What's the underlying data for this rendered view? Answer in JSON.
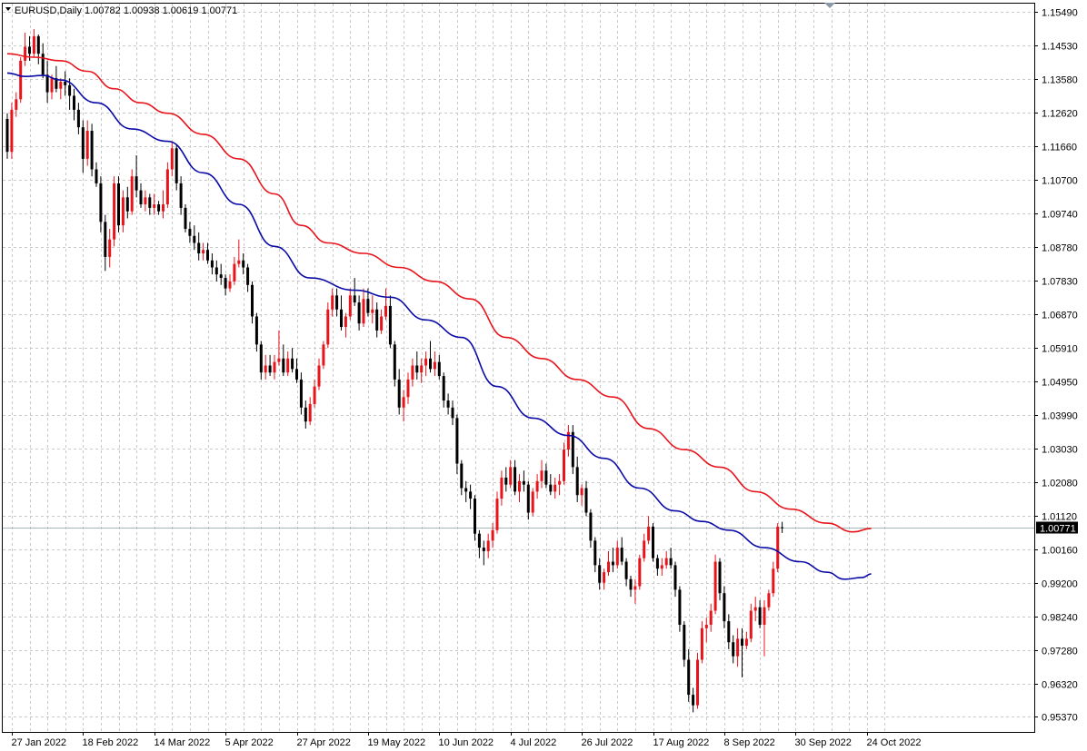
{
  "header": {
    "symbol_label": "EURUSD,Daily",
    "ohlc_label": "1.00782 1.00938 1.00619 1.00771"
  },
  "colors": {
    "bull_candle": "#e8141c",
    "bear_candle": "#000000",
    "ma_fast": "#0a0aa8",
    "ma_slow": "#e8141c",
    "grid": "#c8c8c8",
    "current_price_line": "#a8b4bc",
    "price_box": "#000000"
  },
  "icons": {
    "indicator_marker": "triangle-down-icon"
  },
  "chart_data": {
    "type": "candlestick",
    "symbol": "EURUSD",
    "timeframe": "Daily",
    "ohlc": {
      "open": 1.00782,
      "high": 1.00938,
      "low": 1.00619,
      "close": 1.00771
    },
    "current_price": 1.00771,
    "current_price_label": "1.00771",
    "ylim": [
      0.9494,
      1.1573
    ],
    "y_ticks": [
      "1.15490",
      "1.14530",
      "1.13580",
      "1.12620",
      "1.11660",
      "1.10700",
      "1.09740",
      "1.08780",
      "1.07830",
      "1.06870",
      "1.05910",
      "1.04950",
      "1.03990",
      "1.03030",
      "1.02080",
      "1.01120",
      "1.00160",
      "0.99200",
      "0.98240",
      "0.97280",
      "0.96320",
      "0.95370"
    ],
    "x_ticks": [
      {
        "label": "27 Jan 2022",
        "index": 1
      },
      {
        "label": "18 Feb 2022",
        "index": 17
      },
      {
        "label": "14 Mar 2022",
        "index": 33
      },
      {
        "label": "5 Apr 2022",
        "index": 49
      },
      {
        "label": "27 Apr 2022",
        "index": 65
      },
      {
        "label": "19 May 2022",
        "index": 81
      },
      {
        "label": "10 Jun 2022",
        "index": 97
      },
      {
        "label": "4 Jul 2022",
        "index": 113
      },
      {
        "label": "26 Jul 2022",
        "index": 129
      },
      {
        "label": "17 Aug 2022",
        "index": 145
      },
      {
        "label": "8 Sep 2022",
        "index": 161
      },
      {
        "label": "30 Sep 2022",
        "index": 177
      },
      {
        "label": "24 Oct 2022",
        "index": 193
      }
    ],
    "grid": true,
    "candles": [
      [
        1.1244,
        1.126,
        1.113,
        1.115
      ],
      [
        1.115,
        1.129,
        1.113,
        1.127
      ],
      [
        1.127,
        1.132,
        1.125,
        1.13
      ],
      [
        1.13,
        1.142,
        1.129,
        1.141
      ],
      [
        1.141,
        1.149,
        1.1395,
        1.145
      ],
      [
        1.145,
        1.148,
        1.141,
        1.143
      ],
      [
        1.143,
        1.15,
        1.142,
        1.148
      ],
      [
        1.148,
        1.1485,
        1.14,
        1.143
      ],
      [
        1.143,
        1.146,
        1.136,
        1.137
      ],
      [
        1.137,
        1.141,
        1.129,
        1.132
      ],
      [
        1.132,
        1.137,
        1.13,
        1.136
      ],
      [
        1.136,
        1.1395,
        1.132,
        1.133
      ],
      [
        1.133,
        1.136,
        1.13,
        1.135
      ],
      [
        1.135,
        1.138,
        1.131,
        1.134
      ],
      [
        1.134,
        1.136,
        1.127,
        1.131
      ],
      [
        1.131,
        1.133,
        1.124,
        1.127
      ],
      [
        1.127,
        1.129,
        1.12,
        1.122
      ],
      [
        1.122,
        1.124,
        1.109,
        1.113
      ],
      [
        1.113,
        1.124,
        1.111,
        1.121
      ],
      [
        1.121,
        1.123,
        1.108,
        1.11
      ],
      [
        1.11,
        1.112,
        1.105,
        1.106
      ],
      [
        1.106,
        1.108,
        1.092,
        1.095
      ],
      [
        1.095,
        1.097,
        1.081,
        1.085
      ],
      [
        1.085,
        1.093,
        1.082,
        1.09
      ],
      [
        1.09,
        1.108,
        1.088,
        1.106
      ],
      [
        1.106,
        1.108,
        1.092,
        1.094
      ],
      [
        1.094,
        1.104,
        1.092,
        1.102
      ],
      [
        1.102,
        1.105,
        1.096,
        1.098
      ],
      [
        1.098,
        1.11,
        1.097,
        1.108
      ],
      [
        1.108,
        1.114,
        1.102,
        1.104
      ],
      [
        1.104,
        1.106,
        1.099,
        1.1
      ],
      [
        1.1,
        1.104,
        1.098,
        1.102
      ],
      [
        1.102,
        1.103,
        1.097,
        1.099
      ],
      [
        1.099,
        1.103,
        1.097,
        1.1
      ],
      [
        1.1,
        1.101,
        1.097,
        1.098
      ],
      [
        1.098,
        1.104,
        1.096,
        1.1
      ],
      [
        1.1,
        1.112,
        1.099,
        1.11
      ],
      [
        1.11,
        1.118,
        1.108,
        1.116
      ],
      [
        1.116,
        1.117,
        1.104,
        1.106
      ],
      [
        1.106,
        1.108,
        1.097,
        1.099
      ],
      [
        1.099,
        1.1,
        1.092,
        1.093
      ],
      [
        1.093,
        1.095,
        1.089,
        1.091
      ],
      [
        1.091,
        1.094,
        1.087,
        1.089
      ],
      [
        1.089,
        1.092,
        1.084,
        1.086
      ],
      [
        1.086,
        1.089,
        1.084,
        1.087
      ],
      [
        1.087,
        1.089,
        1.083,
        1.084
      ],
      [
        1.084,
        1.086,
        1.08,
        1.082
      ],
      [
        1.082,
        1.084,
        1.078,
        1.08
      ],
      [
        1.08,
        1.083,
        1.077,
        1.079
      ],
      [
        1.079,
        1.08,
        1.074,
        1.076
      ],
      [
        1.076,
        1.08,
        1.075,
        1.078
      ],
      [
        1.078,
        1.085,
        1.077,
        1.083
      ],
      [
        1.083,
        1.09,
        1.082,
        1.084
      ],
      [
        1.084,
        1.086,
        1.08,
        1.082
      ],
      [
        1.082,
        1.083,
        1.075,
        1.077
      ],
      [
        1.077,
        1.078,
        1.066,
        1.068
      ],
      [
        1.068,
        1.069,
        1.058,
        1.06
      ],
      [
        1.06,
        1.061,
        1.05,
        1.052
      ],
      [
        1.052,
        1.057,
        1.05,
        1.054
      ],
      [
        1.054,
        1.057,
        1.051,
        1.052
      ],
      [
        1.052,
        1.057,
        1.05,
        1.055
      ],
      [
        1.055,
        1.064,
        1.054,
        1.056
      ],
      [
        1.056,
        1.06,
        1.051,
        1.052
      ],
      [
        1.052,
        1.058,
        1.051,
        1.056
      ],
      [
        1.056,
        1.059,
        1.052,
        1.053
      ],
      [
        1.053,
        1.056,
        1.049,
        1.05
      ],
      [
        1.05,
        1.052,
        1.04,
        1.042
      ],
      [
        1.042,
        1.044,
        1.036,
        1.038
      ],
      [
        1.038,
        1.045,
        1.037,
        1.043
      ],
      [
        1.043,
        1.05,
        1.042,
        1.048
      ],
      [
        1.048,
        1.056,
        1.047,
        1.054
      ],
      [
        1.054,
        1.061,
        1.053,
        1.06
      ],
      [
        1.06,
        1.072,
        1.059,
        1.07
      ],
      [
        1.07,
        1.076,
        1.068,
        1.074
      ],
      [
        1.074,
        1.076,
        1.068,
        1.07
      ],
      [
        1.07,
        1.074,
        1.064,
        1.065
      ],
      [
        1.065,
        1.069,
        1.062,
        1.068
      ],
      [
        1.068,
        1.076,
        1.067,
        1.074
      ],
      [
        1.074,
        1.079,
        1.071,
        1.072
      ],
      [
        1.072,
        1.074,
        1.064,
        1.066
      ],
      [
        1.066,
        1.076,
        1.065,
        1.073
      ],
      [
        1.073,
        1.076,
        1.068,
        1.069
      ],
      [
        1.069,
        1.074,
        1.066,
        1.07
      ],
      [
        1.07,
        1.072,
        1.062,
        1.064
      ],
      [
        1.064,
        1.07,
        1.063,
        1.068
      ],
      [
        1.068,
        1.076,
        1.067,
        1.071
      ],
      [
        1.071,
        1.074,
        1.059,
        1.06
      ],
      [
        1.06,
        1.061,
        1.048,
        1.05
      ],
      [
        1.05,
        1.053,
        1.04,
        1.042
      ],
      [
        1.042,
        1.047,
        1.038,
        1.045
      ],
      [
        1.045,
        1.052,
        1.043,
        1.05
      ],
      [
        1.05,
        1.056,
        1.048,
        1.054
      ],
      [
        1.054,
        1.058,
        1.05,
        1.052
      ],
      [
        1.052,
        1.056,
        1.049,
        1.054
      ],
      [
        1.054,
        1.058,
        1.051,
        1.056
      ],
      [
        1.056,
        1.061,
        1.052,
        1.053
      ],
      [
        1.053,
        1.058,
        1.051,
        1.055
      ],
      [
        1.055,
        1.057,
        1.05,
        1.051
      ],
      [
        1.051,
        1.052,
        1.042,
        1.044
      ],
      [
        1.044,
        1.046,
        1.04,
        1.042
      ],
      [
        1.042,
        1.044,
        1.037,
        1.039
      ],
      [
        1.039,
        1.04,
        1.023,
        1.026
      ],
      [
        1.026,
        1.027,
        1.017,
        1.019
      ],
      [
        1.019,
        1.021,
        1.015,
        1.018
      ],
      [
        1.018,
        1.02,
        1.013,
        1.016
      ],
      [
        1.016,
        1.017,
        1.004,
        1.006
      ],
      [
        1.006,
        1.007,
        0.999,
        1.002
      ],
      [
        1.002,
        1.004,
        0.997,
        1.001
      ],
      [
        1.001,
        1.006,
        0.999,
        1.004
      ],
      [
        1.004,
        1.009,
        1.002,
        1.007
      ],
      [
        1.007,
        1.018,
        1.006,
        1.016
      ],
      [
        1.016,
        1.024,
        1.014,
        1.022
      ],
      [
        1.022,
        1.025,
        1.018,
        1.02
      ],
      [
        1.02,
        1.027,
        1.019,
        1.025
      ],
      [
        1.025,
        1.027,
        1.017,
        1.018
      ],
      [
        1.018,
        1.023,
        1.015,
        1.021
      ],
      [
        1.021,
        1.024,
        1.018,
        1.02
      ],
      [
        1.02,
        1.021,
        1.01,
        1.012
      ],
      [
        1.012,
        1.019,
        1.011,
        1.018
      ],
      [
        1.018,
        1.023,
        1.016,
        1.021
      ],
      [
        1.021,
        1.027,
        1.019,
        1.024
      ],
      [
        1.024,
        1.026,
        1.019,
        1.02
      ],
      [
        1.02,
        1.023,
        1.017,
        1.018
      ],
      [
        1.018,
        1.022,
        1.016,
        1.02
      ],
      [
        1.02,
        1.023,
        1.017,
        1.021
      ],
      [
        1.021,
        1.032,
        1.02,
        1.03
      ],
      [
        1.03,
        1.037,
        1.028,
        1.035
      ],
      [
        1.035,
        1.037,
        1.023,
        1.025
      ],
      [
        1.025,
        1.028,
        1.015,
        1.017
      ],
      [
        1.017,
        1.02,
        1.014,
        1.019
      ],
      [
        1.019,
        1.021,
        1.011,
        1.012
      ],
      [
        1.012,
        1.013,
        1.002,
        1.004
      ],
      [
        1.004,
        1.005,
        0.995,
        0.997
      ],
      [
        0.997,
        0.999,
        0.99,
        0.992
      ],
      [
        0.992,
        0.996,
        0.99,
        0.995
      ],
      [
        0.995,
        1.001,
        0.994,
        0.998
      ],
      [
        0.998,
        1.002,
        0.995,
        0.997
      ],
      [
        0.997,
        1.004,
        0.996,
        1.002
      ],
      [
        1.002,
        1.005,
        0.997,
        0.998
      ],
      [
        0.998,
        0.999,
        0.991,
        0.993
      ],
      [
        0.993,
        0.994,
        0.988,
        0.99
      ],
      [
        0.99,
        0.993,
        0.986,
        0.991
      ],
      [
        0.991,
        1.0,
        0.99,
        0.999
      ],
      [
        0.999,
        1.006,
        0.998,
        1.004
      ],
      [
        1.004,
        1.011,
        1.003,
        1.008
      ],
      [
        1.008,
        1.009,
        0.998,
        0.999
      ],
      [
        0.999,
        1.0,
        0.994,
        0.996
      ],
      [
        0.996,
        0.999,
        0.994,
        0.997
      ],
      [
        0.997,
        1.001,
        0.996,
        0.999
      ],
      [
        0.999,
        1.002,
        0.996,
        0.997
      ],
      [
        0.997,
        0.998,
        0.988,
        0.99
      ],
      [
        0.99,
        0.991,
        0.978,
        0.98
      ],
      [
        0.98,
        0.981,
        0.968,
        0.97
      ],
      [
        0.97,
        0.973,
        0.958,
        0.96
      ],
      [
        0.96,
        0.962,
        0.955,
        0.957
      ],
      [
        0.957,
        0.972,
        0.956,
        0.97
      ],
      [
        0.97,
        0.981,
        0.969,
        0.979
      ],
      [
        0.979,
        0.982,
        0.975,
        0.98
      ],
      [
        0.98,
        0.986,
        0.978,
        0.984
      ],
      [
        0.984,
        1.0,
        0.983,
        0.998
      ],
      [
        0.998,
        0.999,
        0.987,
        0.989
      ],
      [
        0.989,
        0.991,
        0.979,
        0.981
      ],
      [
        0.981,
        0.983,
        0.973,
        0.975
      ],
      [
        0.975,
        0.977,
        0.969,
        0.971
      ],
      [
        0.971,
        0.979,
        0.968,
        0.976
      ],
      [
        0.976,
        0.979,
        0.965,
        0.974
      ],
      [
        0.974,
        0.978,
        0.973,
        0.976
      ],
      [
        0.976,
        0.986,
        0.975,
        0.984
      ],
      [
        0.984,
        0.988,
        0.981,
        0.985
      ],
      [
        0.985,
        0.987,
        0.979,
        0.98
      ],
      [
        0.98,
        0.987,
        0.971,
        0.985
      ],
      [
        0.985,
        0.99,
        0.984,
        0.989
      ],
      [
        0.989,
        0.998,
        0.988,
        0.996
      ],
      [
        0.996,
        1.009,
        0.995,
        1.008
      ],
      [
        1.00782,
        1.00938,
        1.00619,
        1.00771
      ]
    ],
    "ma_fast": {
      "anchors": [
        [
          0,
          1.1375
        ],
        [
          4,
          1.1365
        ],
        [
          8,
          1.1368
        ],
        [
          12,
          1.1355
        ],
        [
          20,
          1.129
        ],
        [
          28,
          1.1215
        ],
        [
          36,
          1.118
        ],
        [
          44,
          1.109
        ],
        [
          52,
          1.1
        ],
        [
          60,
          1.088
        ],
        [
          68,
          1.079
        ],
        [
          78,
          1.0755
        ],
        [
          86,
          1.0735
        ],
        [
          94,
          1.067
        ],
        [
          102,
          1.062
        ],
        [
          110,
          1.048
        ],
        [
          118,
          1.039
        ],
        [
          126,
          1.034
        ],
        [
          134,
          1.0275
        ],
        [
          142,
          1.019
        ],
        [
          150,
          1.0125
        ],
        [
          156,
          1.0095
        ],
        [
          162,
          1.007
        ],
        [
          170,
          1.002
        ],
        [
          178,
          0.998
        ],
        [
          184,
          0.995
        ],
        [
          188,
          0.993
        ],
        [
          192,
          0.9935
        ],
        [
          194,
          0.9945
        ]
      ]
    },
    "ma_slow": {
      "anchors": [
        [
          0,
          1.143
        ],
        [
          6,
          1.142
        ],
        [
          12,
          1.141
        ],
        [
          18,
          1.138
        ],
        [
          24,
          1.133
        ],
        [
          30,
          1.129
        ],
        [
          36,
          1.126
        ],
        [
          44,
          1.12
        ],
        [
          52,
          1.113
        ],
        [
          60,
          1.103
        ],
        [
          66,
          1.094
        ],
        [
          72,
          1.089
        ],
        [
          80,
          1.086
        ],
        [
          88,
          1.082
        ],
        [
          96,
          1.078
        ],
        [
          104,
          1.073
        ],
        [
          112,
          1.062
        ],
        [
          120,
          1.056
        ],
        [
          128,
          1.05
        ],
        [
          136,
          1.045
        ],
        [
          144,
          1.036
        ],
        [
          152,
          1.03
        ],
        [
          160,
          1.025
        ],
        [
          168,
          1.018
        ],
        [
          176,
          1.013
        ],
        [
          184,
          1.009
        ],
        [
          190,
          1.0065
        ],
        [
          194,
          1.0075
        ]
      ]
    }
  }
}
